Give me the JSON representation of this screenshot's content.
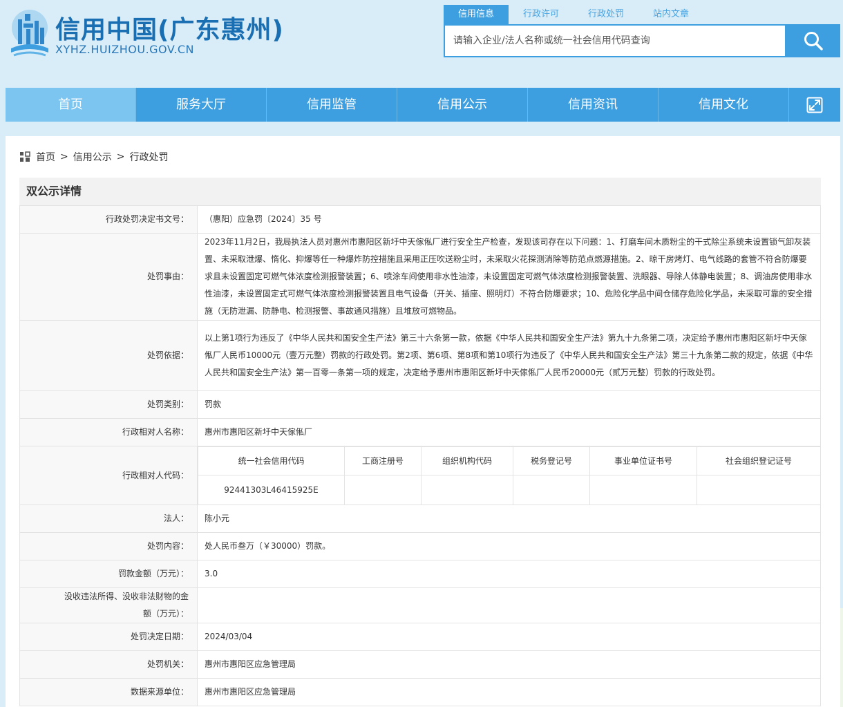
{
  "header": {
    "site_title": "信用中国(广东惠州)",
    "site_url": "XYHZ.HUIZHOU.GOV.CN"
  },
  "search": {
    "tabs": [
      "信用信息",
      "行政许可",
      "行政处罚",
      "站内文章"
    ],
    "active_tab": 0,
    "placeholder": "请输入企业/法人名称或统一社会信用代码查询"
  },
  "nav": {
    "items": [
      "首页",
      "服务大厅",
      "信用监管",
      "信用公示",
      "信用资讯",
      "信用文化"
    ],
    "active": 0
  },
  "breadcrumb": [
    "首页",
    "信用公示",
    "行政处罚"
  ],
  "section_title": "双公示详情",
  "detail": {
    "doc_no": {
      "label": "行政处罚决定书文号：",
      "value": "（惠阳）应急罚〔2024〕35 号"
    },
    "reason": {
      "label": "处罚事由：",
      "value": "2023年11月2日，我局执法人员对惠州市惠阳区新圩中天傢俬厂进行安全生产检查，发现该司存在以下问题：1、打磨车间木质粉尘的干式除尘系统未设置锁气卸灰装置、未采取泄爆、惰化、抑爆等任一种爆炸防控措施且采用正压吹送粉尘时，未采取火花探测消除等防范点燃源措施。2、晾干房烤灯、电气线路的套管不符合防爆要求且未设置固定可燃气体浓度检测报警装置；6、喷涂车间使用非水性油漆，未设置固定可燃气体浓度检测报警装置、洗眼器、导除人体静电装置；8、调油房使用非水性油漆，未设置固定式可燃气体浓度检测报警装置且电气设备（开关、插座、照明灯）不符合防爆要求；10、危险化学品中间仓储存危险化学品，未采取可靠的安全措施（无防泄漏、防静电、检测报警、事故通风措施）且堆放可燃物品。"
    },
    "basis": {
      "label": "处罚依据：",
      "value": "以上第1项行为违反了《中华人民共和国安全生产法》第三十六条第一款，依据《中华人民共和国安全生产法》第九十九条第二项，决定给予惠州市惠阳区新圩中天傢俬厂人民币10000元（壹万元整）罚款的行政处罚。第2项、第6项、第8项和第10项行为违反了《中华人民共和国安全生产法》第三十九条第二款的规定，依据《中华人民共和国安全生产法》第一百零一条第一项的规定，决定给予惠州市惠阳区新圩中天傢俬厂人民币20000元（贰万元整）罚款的行政处罚。"
    },
    "category": {
      "label": "处罚类别：",
      "value": "罚款"
    },
    "party_name": {
      "label": "行政相对人名称：",
      "value": "惠州市惠阳区新圩中天傢俬厂"
    },
    "party_code": {
      "label": "行政相对人代码：",
      "headers": [
        "统一社会信用代码",
        "工商注册号",
        "组织机构代码",
        "税务登记号",
        "事业单位证书号",
        "社会组织登记证号"
      ],
      "values": [
        "92441303L46415925E",
        "",
        "",
        "",
        "",
        ""
      ]
    },
    "legal_person": {
      "label": "法人：",
      "value": "陈小元"
    },
    "content": {
      "label": "处罚内容：",
      "value": "处人民币叁万（￥30000）罚款。"
    },
    "fine": {
      "label": "罚款金额（万元）：",
      "value": "3.0"
    },
    "confiscation": {
      "label": "没收违法所得、没收非法财物的金额（万元）：",
      "value": ""
    },
    "date": {
      "label": "处罚决定日期：",
      "value": "2024/03/04"
    },
    "authority": {
      "label": "处罚机关：",
      "value": "惠州市惠阳区应急管理局"
    },
    "source": {
      "label": "数据来源单位：",
      "value": "惠州市惠阳区应急管理局"
    }
  }
}
